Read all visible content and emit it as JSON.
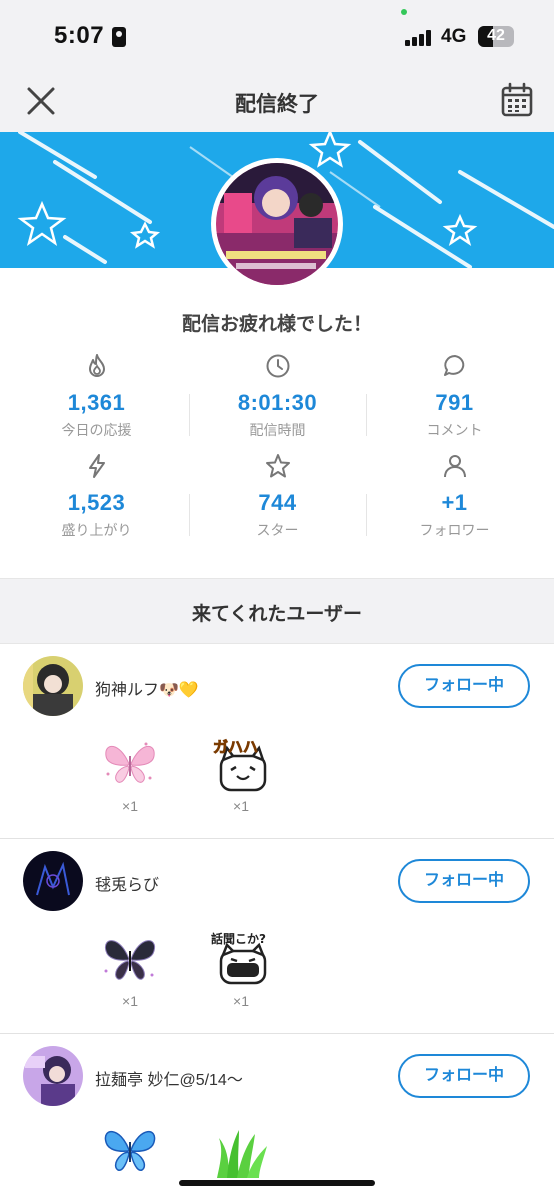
{
  "status_bar": {
    "time": "5:07",
    "network": "4G",
    "battery": "42",
    "battery_level_percent": 42
  },
  "header": {
    "title": "配信終了",
    "close_icon": "close-icon",
    "calendar_icon": "calendar-icon"
  },
  "thanks_message": "配信お疲れ様でした！",
  "stats": [
    {
      "icon": "flame-icon",
      "value": "1,361",
      "label": "今日の応援"
    },
    {
      "icon": "clock-icon",
      "value": "8:01:30",
      "label": "配信時間"
    },
    {
      "icon": "comment-icon",
      "value": "791",
      "label": "コメント"
    },
    {
      "icon": "lightning-icon",
      "value": "1,523",
      "label": "盛り上がり"
    },
    {
      "icon": "star-icon",
      "value": "744",
      "label": "スター"
    },
    {
      "icon": "person-icon",
      "value": "+1",
      "label": "フォロワー"
    }
  ],
  "section_title": "来てくれたユーザー",
  "users": [
    {
      "name": "狗神ルフ🐶💛",
      "follow_label": "フォロー中",
      "gifts": [
        {
          "icon": "pink-butterfly-icon",
          "count": "×1"
        },
        {
          "icon": "gahaha-cat-icon",
          "count": "×1",
          "text": "ガハハ"
        }
      ]
    },
    {
      "name": "毬兎らび",
      "follow_label": "フォロー中",
      "gifts": [
        {
          "icon": "black-butterfly-icon",
          "count": "×1"
        },
        {
          "icon": "masked-cat-icon",
          "count": "×1",
          "text": "話聞こか?"
        }
      ]
    },
    {
      "name": "拉麺亭 妙仁@5/14〜",
      "follow_label": "フォロー中",
      "gifts": [
        {
          "icon": "blue-butterfly-icon",
          "count": ""
        },
        {
          "icon": "grass-icon",
          "count": ""
        }
      ]
    }
  ],
  "colors": {
    "accent": "#1e88d8",
    "banner": "#1ea8ea",
    "background_gray": "#f2f2f4"
  }
}
